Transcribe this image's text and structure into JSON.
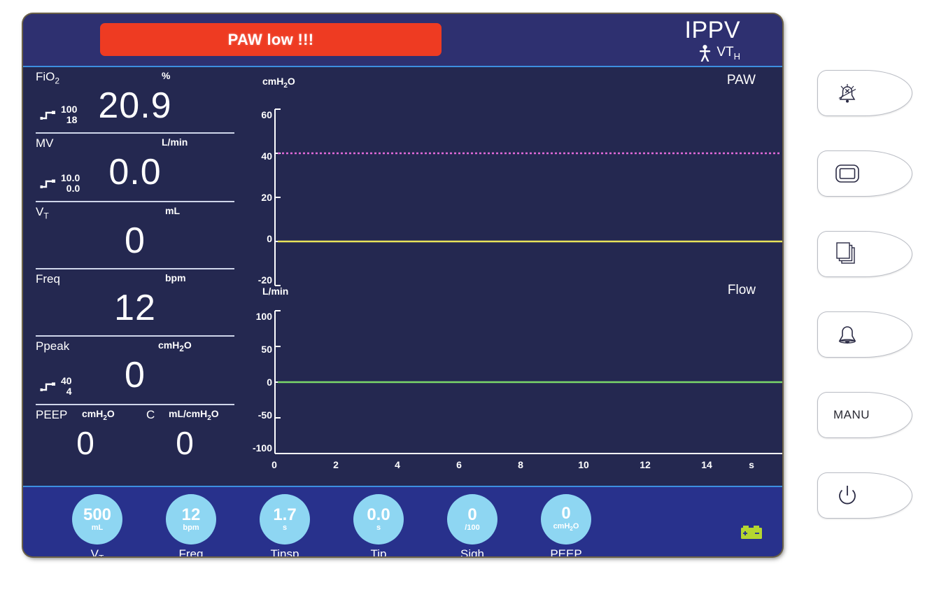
{
  "header": {
    "alarm_message": "PAW low !!!",
    "mode": "IPPV",
    "patient_icon": "patient-adult-icon",
    "patient_label": "VT",
    "patient_label_sub": "H"
  },
  "measurements": [
    {
      "label": "FiO",
      "label_sub": "2",
      "unit": "%",
      "value": "20.9",
      "limit_high": "100",
      "limit_low": "18",
      "has_limits": true
    },
    {
      "label": "MV",
      "label_sub": "",
      "unit": "L/min",
      "value": "0.0",
      "limit_high": "10.0",
      "limit_low": "0.0",
      "has_limits": true
    },
    {
      "label": "VT",
      "label_sub": "",
      "unit": "mL",
      "value": "0",
      "limit_high": "",
      "limit_low": "",
      "has_limits": false
    },
    {
      "label": "Freq",
      "label_sub": "",
      "unit": "bpm",
      "value": "12",
      "limit_high": "",
      "limit_low": "",
      "has_limits": false
    },
    {
      "label": "Ppeak",
      "label_sub": "",
      "unit": "cmH2O",
      "value": "0",
      "limit_high": "40",
      "limit_low": "4",
      "has_limits": true
    }
  ],
  "dual_row": {
    "left_label": "PEEP",
    "left_unit": "cmH2O",
    "left_value": "0",
    "right_label": "C",
    "right_unit": "mL/cmH2O",
    "right_value": "0"
  },
  "chart_data": [
    {
      "type": "line",
      "title": "PAW",
      "ylabel": "cmH2O",
      "xlabel": "s",
      "ylim": [
        -20,
        60
      ],
      "yticks": [
        "60",
        "40",
        "20",
        "0",
        "-20"
      ],
      "ytick_values": [
        60,
        40,
        20,
        0,
        -20
      ],
      "xlim": [
        0,
        16
      ],
      "xticks": [
        "0",
        "2",
        "4",
        "6",
        "8",
        "10",
        "12",
        "14"
      ],
      "xtick_values": [
        0,
        2,
        4,
        6,
        8,
        10,
        12,
        14
      ],
      "grid": false,
      "series": [
        {
          "name": "Paw high alarm limit",
          "style": "dotted",
          "color": "#e06ad8",
          "constant_y": 40
        },
        {
          "name": "Paw waveform",
          "style": "solid",
          "color": "#e8e45a",
          "constant_y": 0
        }
      ]
    },
    {
      "type": "line",
      "title": "Flow",
      "ylabel": "L/min",
      "xlabel": "s",
      "ylim": [
        -100,
        100
      ],
      "yticks": [
        "100",
        "50",
        "0",
        "-50",
        "-100"
      ],
      "ytick_values": [
        100,
        50,
        0,
        -50,
        -100
      ],
      "xlim": [
        0,
        16
      ],
      "xticks": [
        "0",
        "2",
        "4",
        "6",
        "8",
        "10",
        "12",
        "14"
      ],
      "xtick_values": [
        0,
        2,
        4,
        6,
        8,
        10,
        12,
        14
      ],
      "grid": false,
      "series": [
        {
          "name": "Flow waveform",
          "style": "solid",
          "color": "#7ad96a",
          "constant_y": 0
        }
      ]
    }
  ],
  "settings": [
    {
      "value": "500",
      "unit": "mL",
      "unit_sub": "",
      "name": "VT",
      "name_sub": ""
    },
    {
      "value": "12",
      "unit": "bpm",
      "unit_sub": "",
      "name": "Freq",
      "name_sub": ""
    },
    {
      "value": "1.7",
      "unit": "s",
      "unit_sub": "",
      "name": "Tinsp",
      "name_sub": ""
    },
    {
      "value": "0.0",
      "unit": "s",
      "unit_sub": "",
      "name": "Tip",
      "name_sub": ""
    },
    {
      "value": "0",
      "unit": "/100",
      "unit_sub": "",
      "name": "Sigh",
      "name_sub": ""
    },
    {
      "value": "0",
      "unit": "cmH2O",
      "unit_sub": "",
      "name": "PEEP",
      "name_sub": ""
    }
  ],
  "footer": {
    "battery_icon": "battery-icon"
  },
  "keys": [
    {
      "icon": "alarm-mute-icon",
      "label": ""
    },
    {
      "icon": "screen-display-icon",
      "label": ""
    },
    {
      "icon": "pages-icon",
      "label": ""
    },
    {
      "icon": "alarm-bell-icon",
      "label": ""
    },
    {
      "icon": "",
      "label": "MANU"
    },
    {
      "icon": "power-icon",
      "label": ""
    }
  ],
  "colors": {
    "alarm_red": "#ee3b22",
    "screen_bg": "#242850",
    "header_bg": "#2e3070",
    "footer_bg": "#28318c",
    "accent_blue": "#3d8fe0",
    "bubble_blue": "#8ed6f2",
    "paw_limit_line": "#e06ad8",
    "paw_wave": "#e8e45a",
    "flow_wave": "#7ad96a",
    "battery_green": "#b5d630"
  }
}
